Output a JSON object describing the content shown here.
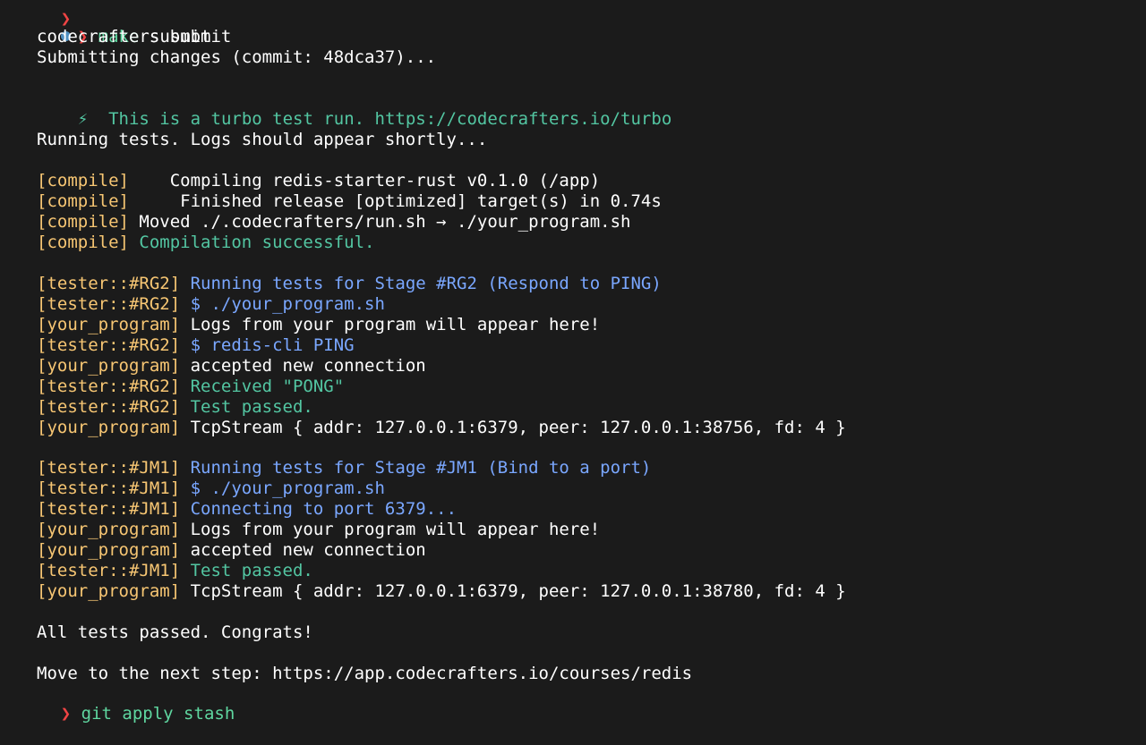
{
  "prompt": {
    "arrow": "❯",
    "command_keyword": "make",
    "command_arg": " submit"
  },
  "next_prompt": {
    "arrow": "❯",
    "command": "git apply stash"
  },
  "output": {
    "line1": "codecrafters submit",
    "line2": "Submitting changes (commit: 48dca37)...",
    "turbo_icon": "⚡",
    "turbo_text": "This is a turbo test run. https://codecrafters.io/turbo",
    "running": "Running tests. Logs should appear shortly...",
    "compile": [
      {
        "tag": "[compile]",
        "text": "    Compiling redis-starter-rust v0.1.0 (/app)",
        "color": "white"
      },
      {
        "tag": "[compile]",
        "text": "     Finished release [optimized] target(s) in 0.74s",
        "color": "white"
      },
      {
        "tag": "[compile]",
        "text": " Moved ./.codecrafters/run.sh → ./your_program.sh",
        "color": "white"
      },
      {
        "tag": "[compile]",
        "text": " Compilation successful.",
        "color": "green"
      }
    ],
    "stage1": [
      {
        "tag": "[tester::#RG2]",
        "text": " Running tests for Stage #RG2 (Respond to PING)",
        "color": "blue"
      },
      {
        "tag": "[tester::#RG2]",
        "text": " $ ./your_program.sh",
        "color": "blue"
      },
      {
        "tag": "[your_program]",
        "text": " Logs from your program will appear here!",
        "color": "white"
      },
      {
        "tag": "[tester::#RG2]",
        "text": " $ redis-cli PING",
        "color": "blue"
      },
      {
        "tag": "[your_program]",
        "text": " accepted new connection",
        "color": "white"
      },
      {
        "tag": "[tester::#RG2]",
        "text": " Received \"PONG\"",
        "color": "green"
      },
      {
        "tag": "[tester::#RG2]",
        "text": " Test passed.",
        "color": "green"
      },
      {
        "tag": "[your_program]",
        "text": " TcpStream { addr: 127.0.0.1:6379, peer: 127.0.0.1:38756, fd: 4 }",
        "color": "white"
      }
    ],
    "stage2": [
      {
        "tag": "[tester::#JM1]",
        "text": " Running tests for Stage #JM1 (Bind to a port)",
        "color": "blue"
      },
      {
        "tag": "[tester::#JM1]",
        "text": " $ ./your_program.sh",
        "color": "blue"
      },
      {
        "tag": "[tester::#JM1]",
        "text": " Connecting to port 6379...",
        "color": "blue"
      },
      {
        "tag": "[your_program]",
        "text": " Logs from your program will appear here!",
        "color": "white"
      },
      {
        "tag": "[your_program]",
        "text": " accepted new connection",
        "color": "white"
      },
      {
        "tag": "[tester::#JM1]",
        "text": " Test passed.",
        "color": "green"
      },
      {
        "tag": "[your_program]",
        "text": " TcpStream { addr: 127.0.0.1:6379, peer: 127.0.0.1:38780, fd: 4 }",
        "color": "white"
      }
    ],
    "all_passed": "All tests passed. Congrats!",
    "next_step": "Move to the next step: https://app.codecrafters.io/courses/redis"
  },
  "colors": {
    "background": "#1b1b1b",
    "tag": "#f7c673",
    "blue": "#7aa7ff",
    "green": "#53c6a2",
    "prompt_arrow": "#ef4444",
    "prompt_dot": "#4f8fc0"
  }
}
